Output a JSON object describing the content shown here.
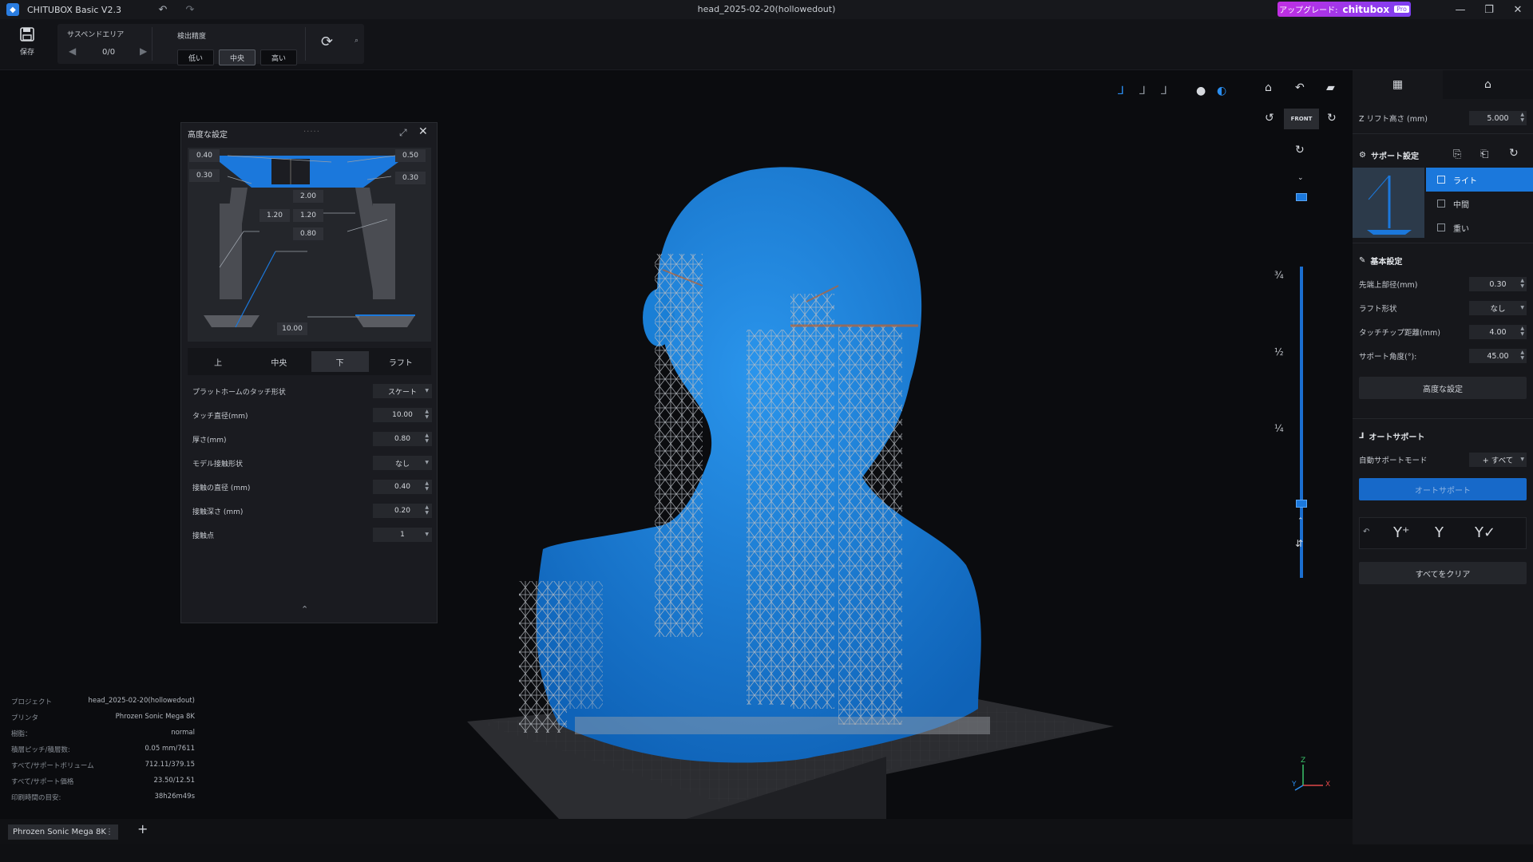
{
  "titlebar": {
    "app_title": "CHITUBOX Basic V2.3",
    "file_name": "head_2025-02-20(hollowedout)",
    "upgrade_label": "アップグレード:",
    "upgrade_brand": "chitubox",
    "upgrade_badge": "Pro"
  },
  "toolbar": {
    "save_label": "保存",
    "suspend_label": "サスペンドエリア",
    "suspend_count": "0/0",
    "precision_label": "検出精度",
    "precision_options": [
      "低い",
      "中央",
      "高い"
    ],
    "precision_selected": "中央"
  },
  "advanced": {
    "title": "高度な設定",
    "diagram_labels": {
      "top_left_a": "0.40",
      "top_left_b": "0.30",
      "top_right_a": "0.50",
      "top_right_b": "0.30",
      "mid_center": "2.00",
      "mid_left": "1.20",
      "mid_right": "1.20",
      "lower": "0.80",
      "base": "10.00"
    },
    "tabs": [
      "上",
      "中央",
      "下",
      "ラフト"
    ],
    "active_tab": "下",
    "params": [
      {
        "label": "プラットホームのタッチ形状",
        "value": "スケート",
        "kind": "select"
      },
      {
        "label": "タッチ直径(mm)",
        "value": "10.00",
        "kind": "spin"
      },
      {
        "label": "厚さ(mm)",
        "value": "0.80",
        "kind": "spin"
      },
      {
        "label": "モデル接触形状",
        "value": "なし",
        "kind": "select"
      },
      {
        "label": "接触の直径 (mm)",
        "value": "0.40",
        "kind": "spin"
      },
      {
        "label": "接触深さ (mm)",
        "value": "0.20",
        "kind": "spin"
      },
      {
        "label": "接触点",
        "value": "1",
        "kind": "select"
      }
    ]
  },
  "info": [
    {
      "k": "プロジェクト",
      "v": "head_2025-02-20(hollowedout)"
    },
    {
      "k": "プリンタ",
      "v": "Phrozen Sonic Mega 8K"
    },
    {
      "k": "樹脂：",
      "v": "normal"
    },
    {
      "k": "積層ピッチ/積層数:",
      "v": "0.05 mm/7611"
    },
    {
      "k": "すべて/サポートボリューム",
      "v": "712.11/379.15"
    },
    {
      "k": "すべて/サポート価格",
      "v": "23.50/12.51"
    },
    {
      "k": "印刷時間の目安:",
      "v": "38h26m49s"
    }
  ],
  "bottom": {
    "printer_tab": "Phrozen Sonic Mega 8K"
  },
  "viewport": {
    "view_label": "FRONT",
    "fractions": [
      "¾",
      "½",
      "¼"
    ],
    "axis": {
      "z": "Z",
      "y": "Y",
      "x": "X"
    },
    "slider": {
      "top_fraction": 1.0,
      "bottom_fraction": 0.0
    }
  },
  "right": {
    "z_lift_label": "Z リフト高さ (mm)",
    "z_lift_value": "5.000",
    "support_settings_label": "サポート設定",
    "levels": [
      "ライト",
      "中間",
      "重い"
    ],
    "level_selected": "ライト",
    "basic_label": "基本設定",
    "basic_params": [
      {
        "label": "先端上部径(mm)",
        "value": "0.30",
        "kind": "spin"
      },
      {
        "label": "ラフト形状",
        "value": "なし",
        "kind": "select"
      },
      {
        "label": "タッチチップ距離(mm)",
        "value": "4.00",
        "kind": "spin"
      },
      {
        "label": "サポート角度(°):",
        "value": "45.00",
        "kind": "spin"
      }
    ],
    "advanced_btn": "高度な設定",
    "auto_label": "オートサポート",
    "auto_mode_label": "自動サポートモード",
    "auto_mode_value": "+ すべて",
    "auto_btn": "オートサポート",
    "clear_btn": "すべてをクリア"
  },
  "colors": {
    "accent": "#1b78dc",
    "model": "#1a7fd6",
    "support": "#b8bcc2"
  }
}
